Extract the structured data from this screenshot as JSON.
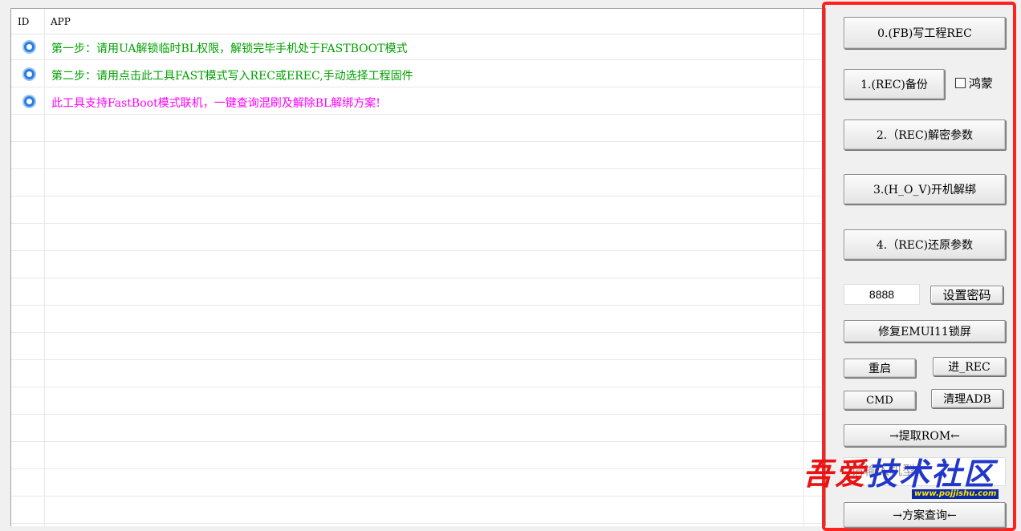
{
  "list": {
    "columns": [
      "ID",
      "APP"
    ],
    "rows": [
      {
        "text": "第一步：请用UA解锁临时BL权限，解锁完毕手机处于FASTBOOT模式",
        "color": "#00a000"
      },
      {
        "text": "第二步：请用点击此工具FAST模式写入REC或EREC,手动选择工程固件",
        "color": "#00a000"
      },
      {
        "text": "此工具支持FastBoot模式联机，一键查询混刷及解除BL解绑方案!",
        "color": "#ff00ff"
      }
    ]
  },
  "panel": {
    "btn_fb": "0.(FB)写工程REC",
    "btn_backup": "1.(REC)备份",
    "chk_hongmeng": "鸿蒙",
    "btn_decrypt": "2.（REC)解密参数",
    "btn_unbind": "3.(H_O_V)开机解绑",
    "btn_restore": "4.（REC)还原参数",
    "password_value": "8888",
    "btn_set_password": "设置密码",
    "btn_fix_emui": "修复EMUI11锁屏",
    "btn_reboot": "重启",
    "btn_enter_rec": "进_REC",
    "btn_cmd": "CMD",
    "btn_clean_adb": "清理ADB",
    "btn_extract_rom": "→提取ROM←",
    "search_placeholder": "请输入机型",
    "btn_query": "→方案查询←"
  },
  "watermark": {
    "chars": [
      "吾",
      "爱",
      "技",
      "术",
      "社",
      "区"
    ],
    "url": "www.pojjishu.com"
  },
  "colors": {
    "border_red": "#ff2020",
    "green_text": "#00a000",
    "magenta_text": "#ff00ff"
  }
}
